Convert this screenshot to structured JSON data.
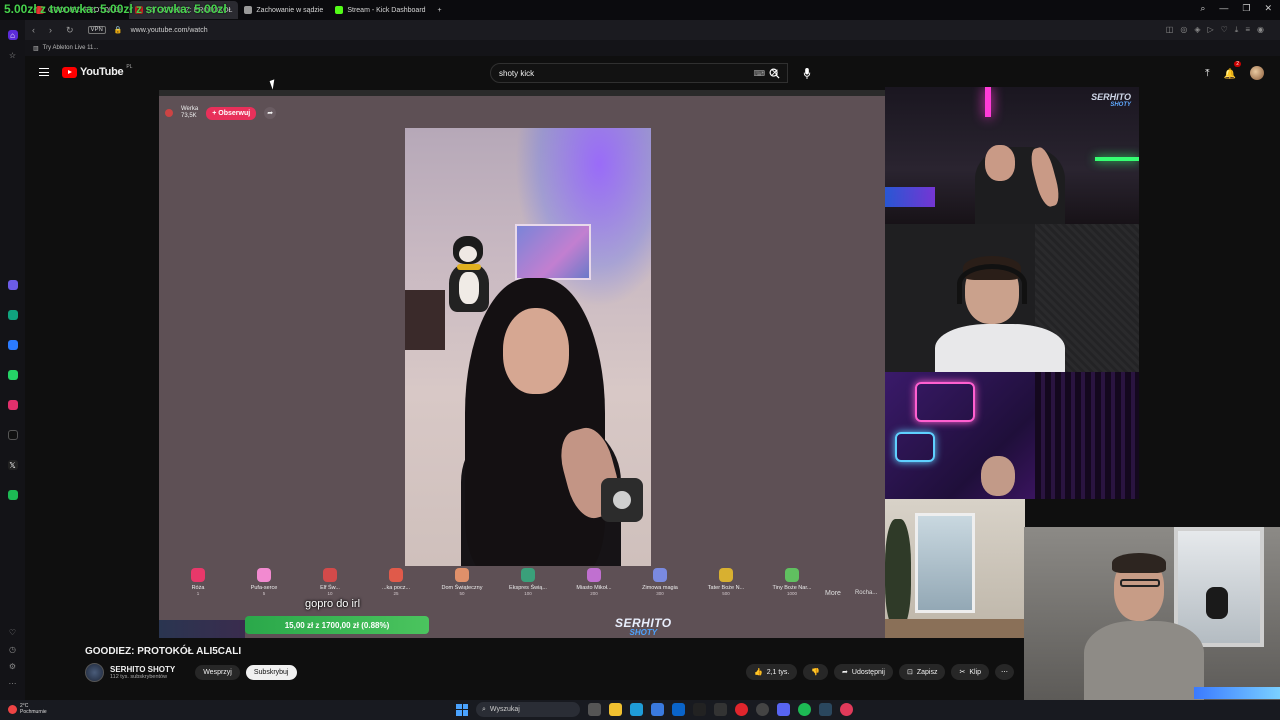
{
  "overlay": {
    "counter_text": "5.00zł z twowka: 5.00zł z srowka: 5.00zł"
  },
  "tabs": [
    {
      "label": "GOODIEZ: PROTOKÓŁ",
      "color": "#e33"
    },
    {
      "label": "(2) GOODIEZ: PROTOKÓŁ",
      "color": "#c22"
    },
    {
      "label": "Zachowanie w sądzie",
      "color": "#999"
    },
    {
      "label": "Stream - Kick Dashboard",
      "color": "#53fc18"
    }
  ],
  "addressbar": {
    "url": "www.youtube.com/watch",
    "vpn": "VPN"
  },
  "bookmarks": {
    "item": "Try Ableton Live 11..."
  },
  "youtube": {
    "logo": "YouTube",
    "country": "PL",
    "search_value": "shoty kick",
    "notif_count": "2"
  },
  "player": {
    "streamer_name": "Werka",
    "streamer_sub": "73,5K",
    "observe_label": "+ Obserwuj",
    "caption": "gopro do irl",
    "goal_text": "15,00 zł z 1700,00 zł (0.88%)",
    "goal_fraction": 0.0088,
    "brand_a": "SERHITO",
    "brand_b": "SHOTY",
    "gifts": [
      {
        "name": "Róża",
        "cost": "1",
        "color": "#e8386a"
      },
      {
        "name": "Pufa-serce",
        "cost": "5",
        "color": "#f28ad0"
      },
      {
        "name": "Elf Św...",
        "cost": "10",
        "color": "#d24a4a"
      },
      {
        "name": "...ka pocz...",
        "cost": "25",
        "color": "#e05a4a"
      },
      {
        "name": "Dom Świąteczny",
        "cost": "50",
        "color": "#e0906a"
      },
      {
        "name": "Ekspres Świą...",
        "cost": "100",
        "color": "#3aa07a"
      },
      {
        "name": "Miasto Mikoł...",
        "cost": "200",
        "color": "#c070d0"
      },
      {
        "name": "Zimowa magia",
        "cost": "300",
        "color": "#7a8ae0"
      },
      {
        "name": "Tater Boże N...",
        "cost": "500",
        "color": "#d8b030"
      },
      {
        "name": "Tiny Boże Nar...",
        "cost": "1000",
        "color": "#60c060"
      }
    ],
    "more_label": "More",
    "last_label": "Rocha..."
  },
  "cam1": {
    "brand_a": "SERHITO",
    "brand_b": "SHOTY"
  },
  "video": {
    "title": "GOODIEZ: PROTOKÓŁ ALI5CALI",
    "channel": "SERHITO SHOTY",
    "subs": "112 tys. subskrybentów",
    "support_label": "Wesprzyj",
    "subscribe_label": "Subskrybuj",
    "likes": "2,1 tys.",
    "share_label": "Udostępnij",
    "save_label": "Zapisz",
    "clip_label": "Klip"
  },
  "taskbar": {
    "temp": "2°C",
    "weather": "Pochmurnie",
    "search_label": "Wyszukaj"
  },
  "colors": {
    "accent_red": "#ff0000",
    "goal_green": "#2aa84a",
    "observe_pink": "#e8305a"
  }
}
